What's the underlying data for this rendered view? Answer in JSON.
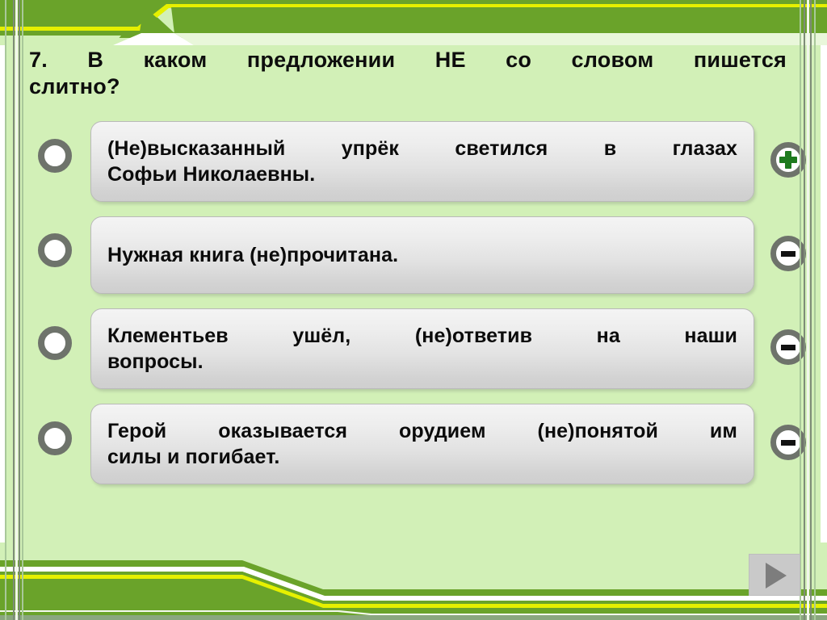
{
  "slide": {
    "background_color": "#d2f0b7",
    "band_color": "#6aa32a",
    "band_accent_color": "#e6f000",
    "question_number": "7.",
    "question_line1": "7.  В  каком  предложении  НЕ  со  словом  пишется",
    "question_line2": "слитно?",
    "question_full": "7. В каком предложении НЕ со словом пишется слитно?"
  },
  "options": [
    {
      "id": "option-1",
      "radio_name": "radio-button",
      "line1": "(Не)высказанный  упрёк  светился  в  глазах",
      "line2": "Софьи Николаевны.",
      "text": "(Не)высказанный упрёк светился в глазах Софьи Николаевны.",
      "score_button": {
        "name": "plus-icon",
        "symbol": "+",
        "color": "#1e7a1e",
        "kind": "plus"
      }
    },
    {
      "id": "option-2",
      "radio_name": "radio-button",
      "line1": "Нужная книга (не)прочитана.",
      "line2": "",
      "text": "Нужная книга (не)прочитана.",
      "score_button": {
        "name": "minus-icon",
        "symbol": "-",
        "color": "#121212",
        "kind": "minus"
      }
    },
    {
      "id": "option-3",
      "radio_name": "radio-button",
      "line1": "Клементьев  ушёл,  (не)ответив  на  наши",
      "line2": "вопросы.",
      "text": "Клементьев ушёл, (не)ответив на наши вопросы.",
      "score_button": {
        "name": "minus-icon",
        "symbol": "-",
        "color": "#121212",
        "kind": "minus"
      }
    },
    {
      "id": "option-4",
      "radio_name": "radio-button",
      "line1": "Герой  оказывается  орудием  (не)понятой  им",
      "line2": "силы и погибает.",
      "text": "Герой оказывается орудием (не)понятой им силы и погибает.",
      "score_button": {
        "name": "minus-icon",
        "symbol": "-",
        "color": "#121212",
        "kind": "minus"
      }
    }
  ],
  "controls": {
    "play_button_name": "play-icon",
    "play_button_label": "▶"
  }
}
